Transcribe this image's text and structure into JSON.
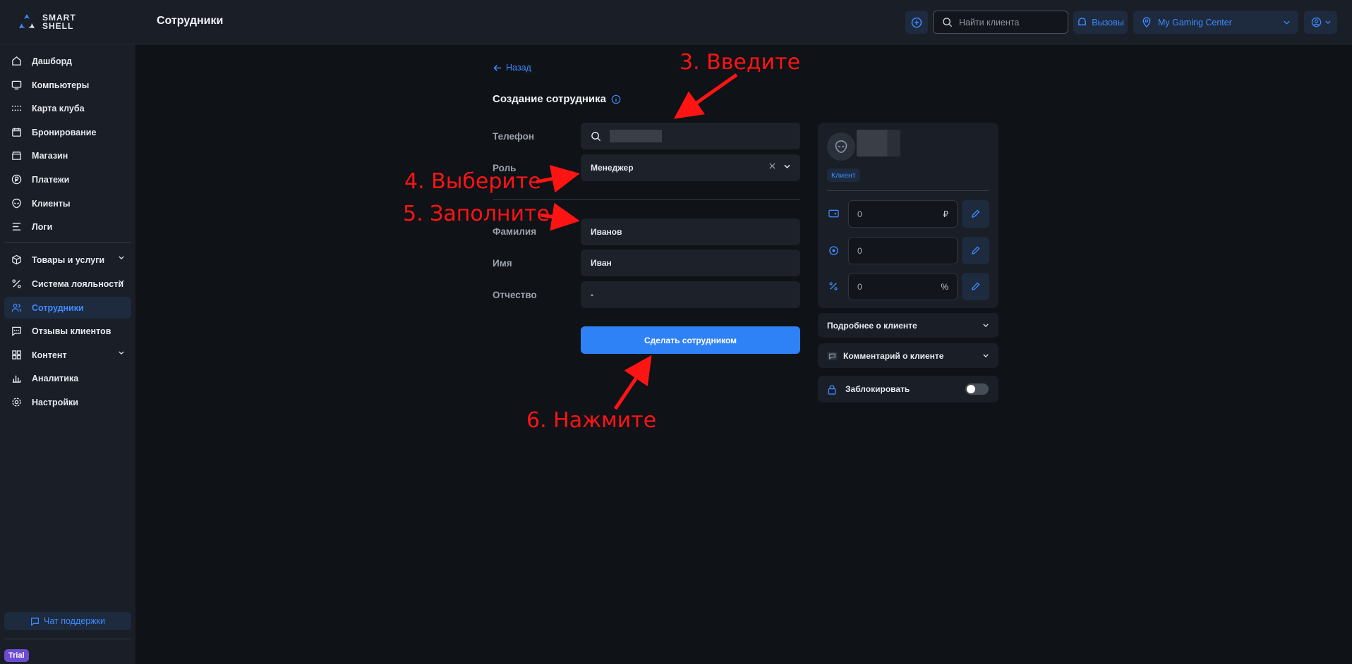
{
  "brand": {
    "line1": "SMART",
    "line2": "SHELL"
  },
  "header": {
    "title": "Сотрудники",
    "search_placeholder": "Найти клиента",
    "calls_label": "Вызовы",
    "club_name": "My Gaming Center"
  },
  "sidebar": {
    "items": [
      {
        "label": "Дашборд",
        "icon": "home-icon"
      },
      {
        "label": "Компьютеры",
        "icon": "monitor-icon"
      },
      {
        "label": "Карта клуба",
        "icon": "grid-dots-icon"
      },
      {
        "label": "Бронирование",
        "icon": "calendar-icon"
      },
      {
        "label": "Магазин",
        "icon": "store-icon"
      },
      {
        "label": "Платежи",
        "icon": "ruble-icon"
      },
      {
        "label": "Клиенты",
        "icon": "alien-icon"
      },
      {
        "label": "Логи",
        "icon": "logs-icon"
      },
      {
        "label": "Товары и услуги",
        "icon": "box-icon"
      },
      {
        "label": "Система лояльности",
        "icon": "percent-icon"
      },
      {
        "label": "Сотрудники",
        "icon": "users-icon"
      },
      {
        "label": "Отзывы клиентов",
        "icon": "chat-icon"
      },
      {
        "label": "Контент",
        "icon": "layout-icon"
      },
      {
        "label": "Аналитика",
        "icon": "chart-icon"
      },
      {
        "label": "Настройки",
        "icon": "gear-icon"
      }
    ],
    "support_label": "Чат поддержки",
    "trial_label": "Trial"
  },
  "form": {
    "back_label": "Назад",
    "title": "Создание сотрудника",
    "phone_label": "Телефон",
    "role_label": "Роль",
    "role_value": "Менеджер",
    "lastname_label": "Фамилия",
    "lastname_value": "Иванов",
    "firstname_label": "Имя",
    "firstname_value": "Иван",
    "middlename_label": "Отчество",
    "middlename_value": "-",
    "submit_label": "Сделать сотрудником"
  },
  "client_card": {
    "badge": "Клиент",
    "balance_value": "0",
    "balance_suffix": "₽",
    "bonus_value": "0",
    "discount_value": "0",
    "discount_suffix": "%",
    "details_label": "Подробнее о клиенте",
    "comment_label": "Комментарий о клиенте",
    "block_label": "Заблокировать"
  },
  "annotations": {
    "step3": "3. Введите",
    "step4": "4. Выберите",
    "step5": "5. Заполните",
    "step6": "6. Нажмите"
  },
  "colors": {
    "accent": "#3d8bff",
    "annotation": "#ff1414",
    "primary_button": "#2f82f5"
  }
}
